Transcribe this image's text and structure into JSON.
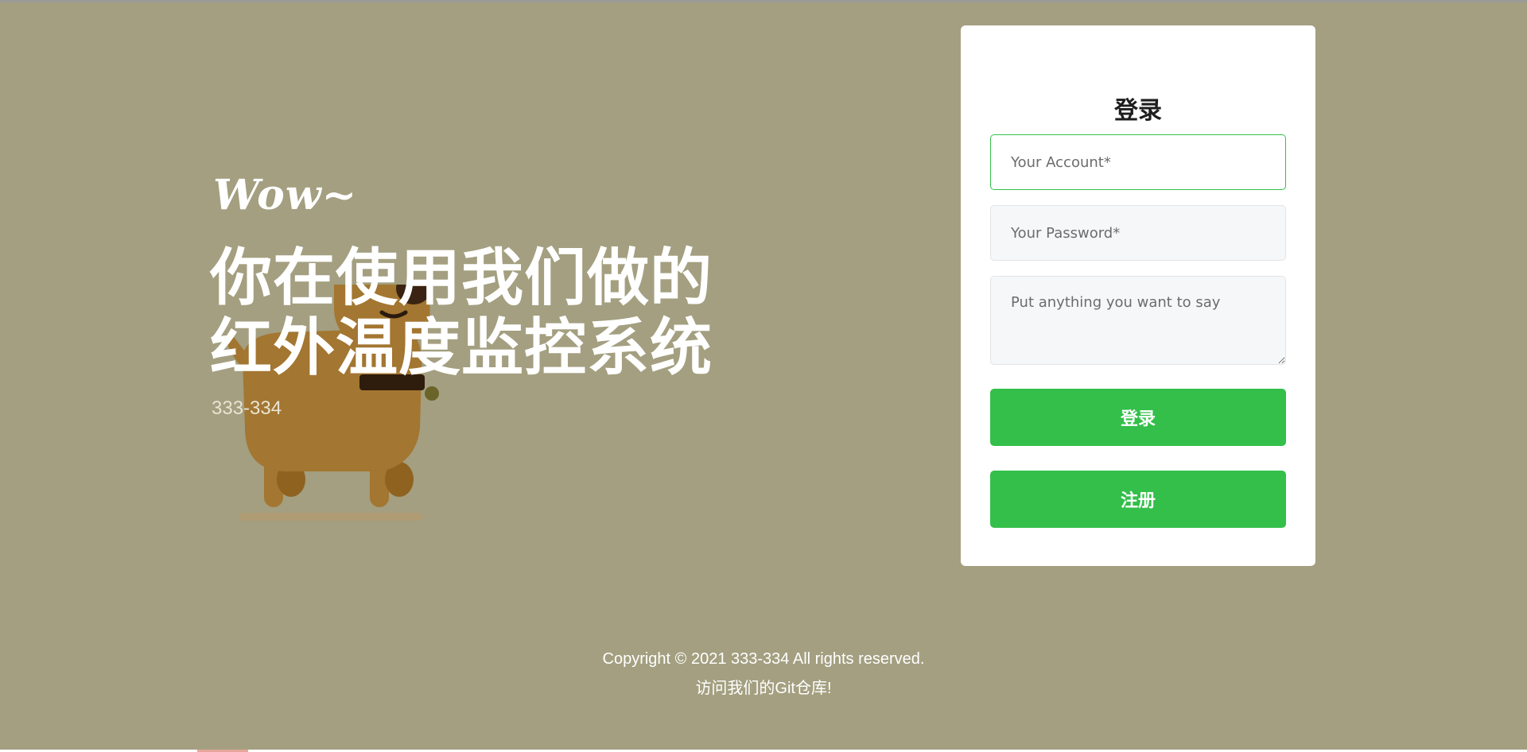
{
  "hero": {
    "greeting": "Wow~",
    "headline_line1": "你在使用我们做的",
    "headline_line2": "红外温度监控系统",
    "subtitle": "333-334",
    "illustration": "dog-icon"
  },
  "login_card": {
    "title": "登录",
    "account_placeholder": "Your Account*",
    "password_placeholder": "Your Password*",
    "message_placeholder": "Put anything you want to say",
    "login_button": "登录",
    "register_button": "注册"
  },
  "footer": {
    "copyright": "Copyright © 2021 333-334 All rights reserved.",
    "git_link": "访问我们的Git仓库!"
  },
  "colors": {
    "background": "#a39f80",
    "accent": "#33bf4a",
    "card": "#ffffff"
  }
}
